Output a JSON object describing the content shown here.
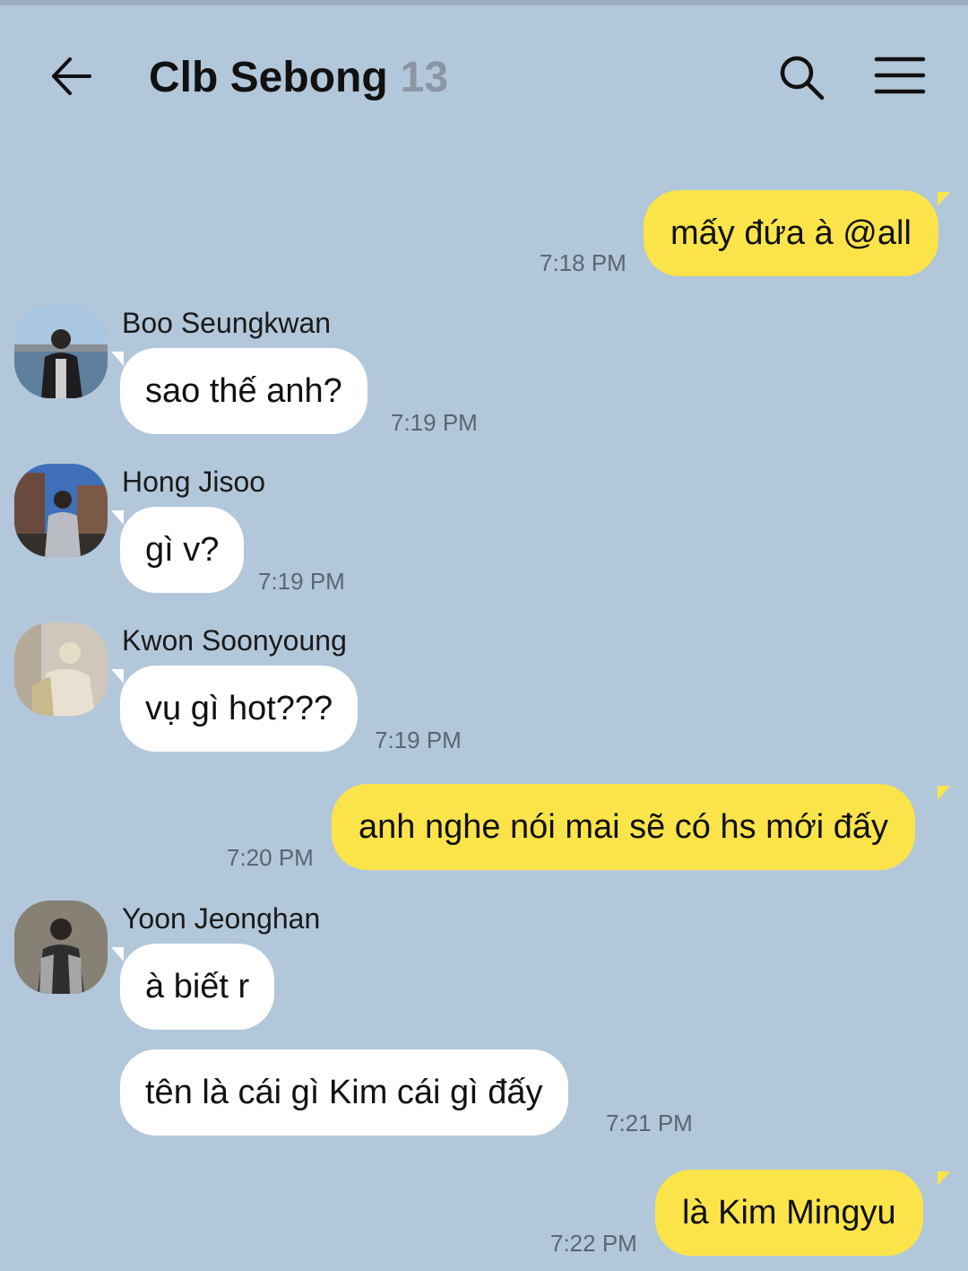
{
  "header": {
    "title": "Clb Sebong",
    "member_count": "13"
  },
  "icons": {
    "back": "arrow-left-icon",
    "search": "search-icon",
    "menu": "hamburger-menu-icon"
  },
  "colors": {
    "background": "#b2c7da",
    "outgoing_bubble": "#fbe44a",
    "incoming_bubble": "#ffffff"
  },
  "messages": [
    {
      "direction": "out",
      "text": "mấy đứa à @all",
      "time": "7:18 PM"
    },
    {
      "direction": "in",
      "sender": "Boo Seungkwan",
      "text": "sao thế anh?",
      "time": "7:19 PM"
    },
    {
      "direction": "in",
      "sender": "Hong Jisoo",
      "text": "gì v?",
      "time": "7:19 PM"
    },
    {
      "direction": "in",
      "sender": "Kwon Soonyoung",
      "text": "vụ gì hot???",
      "time": "7:19 PM"
    },
    {
      "direction": "out",
      "text": "anh nghe nói mai sẽ có hs mới đấy",
      "time": "7:20 PM"
    },
    {
      "direction": "in",
      "sender": "Yoon Jeonghan",
      "text": "à biết r",
      "time": ""
    },
    {
      "direction": "in",
      "text": "tên là cái gì Kim cái gì đấy",
      "time": "7:21 PM"
    },
    {
      "direction": "out",
      "text": "là Kim Mingyu",
      "time": "7:22 PM"
    }
  ]
}
